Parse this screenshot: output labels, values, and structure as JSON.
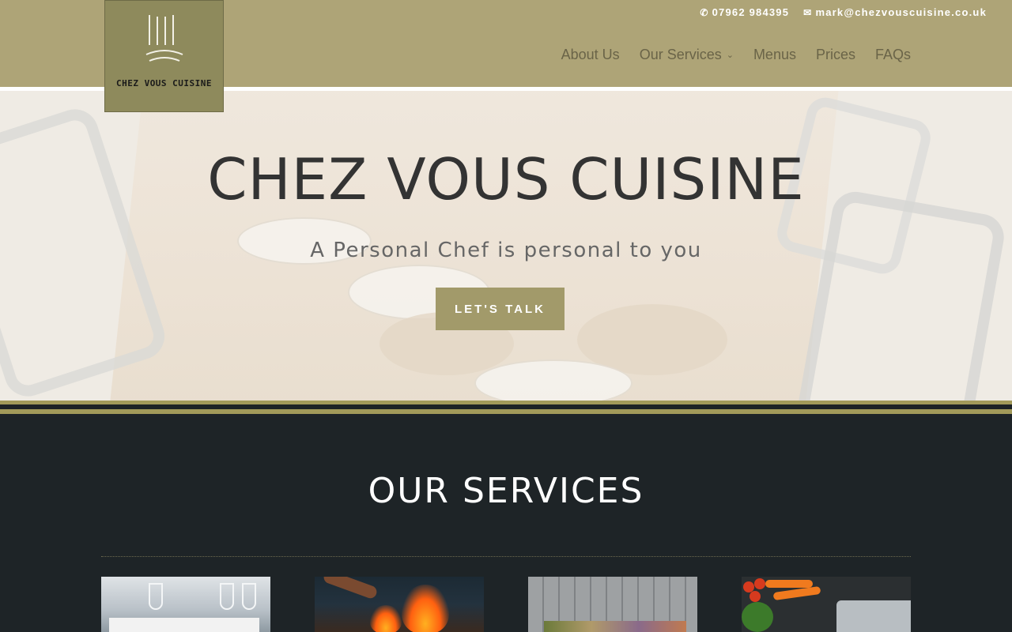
{
  "contact": {
    "phone": "07962 984395",
    "email": "mark@chezvouscuisine.co.uk"
  },
  "logo": {
    "text": "CHEZ VOUS CUISINE"
  },
  "nav": {
    "items": [
      {
        "label": "About Us"
      },
      {
        "label": "Our Services"
      },
      {
        "label": "Menus"
      },
      {
        "label": "Prices"
      },
      {
        "label": "FAQs"
      }
    ]
  },
  "hero": {
    "title": "CHEZ VOUS CUISINE",
    "subtitle": "A Personal Chef is personal to you",
    "cta_label": "LET'S TALK"
  },
  "services": {
    "heading": "OUR SERVICES"
  },
  "colors": {
    "header_bg": "#aea477",
    "accent_gold": "#a29a6a",
    "dark_section": "#1e2427"
  }
}
